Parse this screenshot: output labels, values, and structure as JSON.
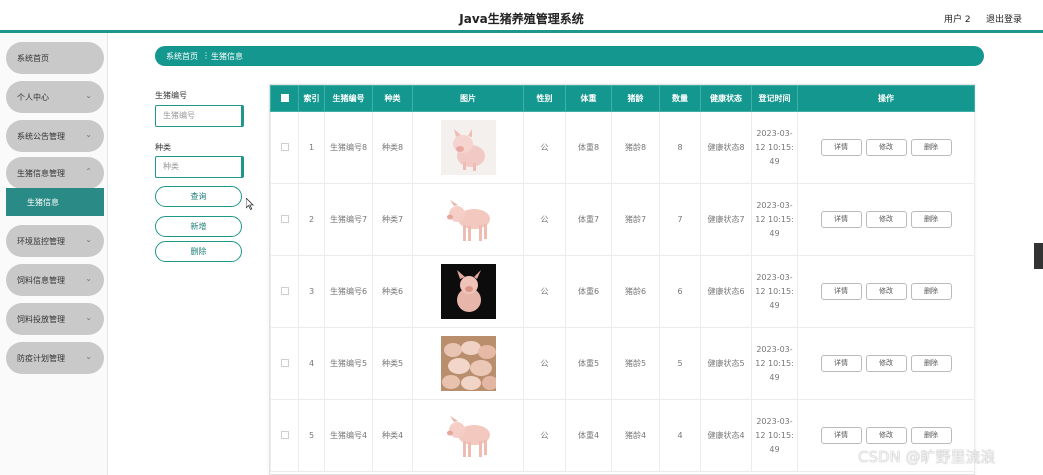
{
  "header": {
    "title": "Java生猪养殖管理系统",
    "user": "用户 2",
    "logout": "退出登录",
    "accent": "#1f968c"
  },
  "sidebar": {
    "items": [
      {
        "label": "系统首页",
        "has_chevron": false
      },
      {
        "label": "个人中心",
        "has_chevron": true
      },
      {
        "label": "系统公告管理",
        "has_chevron": true
      },
      {
        "label": "生猪信息管理",
        "has_chevron": true,
        "expanded": true
      },
      {
        "label": "环境监控管理",
        "has_chevron": true
      },
      {
        "label": "饲料信息管理",
        "has_chevron": true
      },
      {
        "label": "饲料投放管理",
        "has_chevron": true
      },
      {
        "label": "防疫计划管理",
        "has_chevron": true
      }
    ],
    "active_subitem": "生猪信息"
  },
  "breadcrumb": {
    "home": "系统首页",
    "separator": "⋮",
    "current": "生猪信息"
  },
  "search": {
    "field1_label": "生猪编号",
    "field1_placeholder": "生猪编号",
    "field2_label": "种类",
    "field2_placeholder": "种类",
    "query_btn": "查询",
    "add_btn": "新增",
    "delete_btn": "删除"
  },
  "table": {
    "headers": [
      "索引",
      "生猪编号",
      "种类",
      "图片",
      "性别",
      "体重",
      "猪龄",
      "数量",
      "健康状态",
      "登记时间",
      "操作"
    ],
    "rows": [
      {
        "index": "1",
        "code": "生猪编号8",
        "kind": "种类8",
        "pic": "pig-sitting",
        "sex": "公",
        "weight": "体重8",
        "age": "猪龄8",
        "count": "8",
        "health": "健康状态8",
        "time1": "2023-03-",
        "time2": "12 10:15:",
        "time3": "49"
      },
      {
        "index": "2",
        "code": "生猪编号7",
        "kind": "种类7",
        "pic": "pig-standing",
        "sex": "公",
        "weight": "体重7",
        "age": "猪龄7",
        "count": "7",
        "health": "健康状态7",
        "time1": "2023-03-",
        "time2": "12 10:15:",
        "time3": "49"
      },
      {
        "index": "3",
        "code": "生猪编号6",
        "kind": "种类6",
        "pic": "piglet-dark",
        "sex": "公",
        "weight": "体重6",
        "age": "猪龄6",
        "count": "6",
        "health": "健康状态6",
        "time1": "2023-03-",
        "time2": "12 10:15:",
        "time3": "49"
      },
      {
        "index": "4",
        "code": "生猪编号5",
        "kind": "种类5",
        "pic": "pig-herd",
        "sex": "公",
        "weight": "体重5",
        "age": "猪龄5",
        "count": "5",
        "health": "健康状态5",
        "time1": "2023-03-",
        "time2": "12 10:15:",
        "time3": "49"
      },
      {
        "index": "5",
        "code": "生猪编号4",
        "kind": "种类4",
        "pic": "pig-standing",
        "sex": "公",
        "weight": "体重4",
        "age": "猪龄4",
        "count": "4",
        "health": "健康状态4",
        "time1": "2023-03-",
        "time2": "12 10:15:",
        "time3": "49"
      }
    ],
    "actions": {
      "detail": "详情",
      "edit": "修改",
      "delete": "删除"
    }
  },
  "watermark": "CSDN @旷野里流浪"
}
